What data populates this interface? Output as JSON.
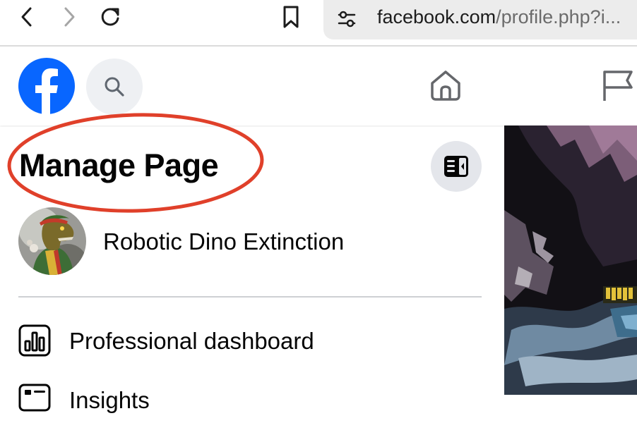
{
  "browser": {
    "url_host": "facebook.com",
    "url_path": "/profile.php?i..."
  },
  "panel": {
    "title": "Manage Page",
    "page_name": "Robotic Dino Extinction",
    "menu": [
      {
        "label": "Professional dashboard",
        "icon": "bar-chart-icon"
      },
      {
        "label": "Insights",
        "icon": "id-card-icon"
      }
    ]
  },
  "colors": {
    "facebook_blue": "#0866ff",
    "annotation_red": "#e0402a",
    "search_bg": "#eef0f3"
  }
}
